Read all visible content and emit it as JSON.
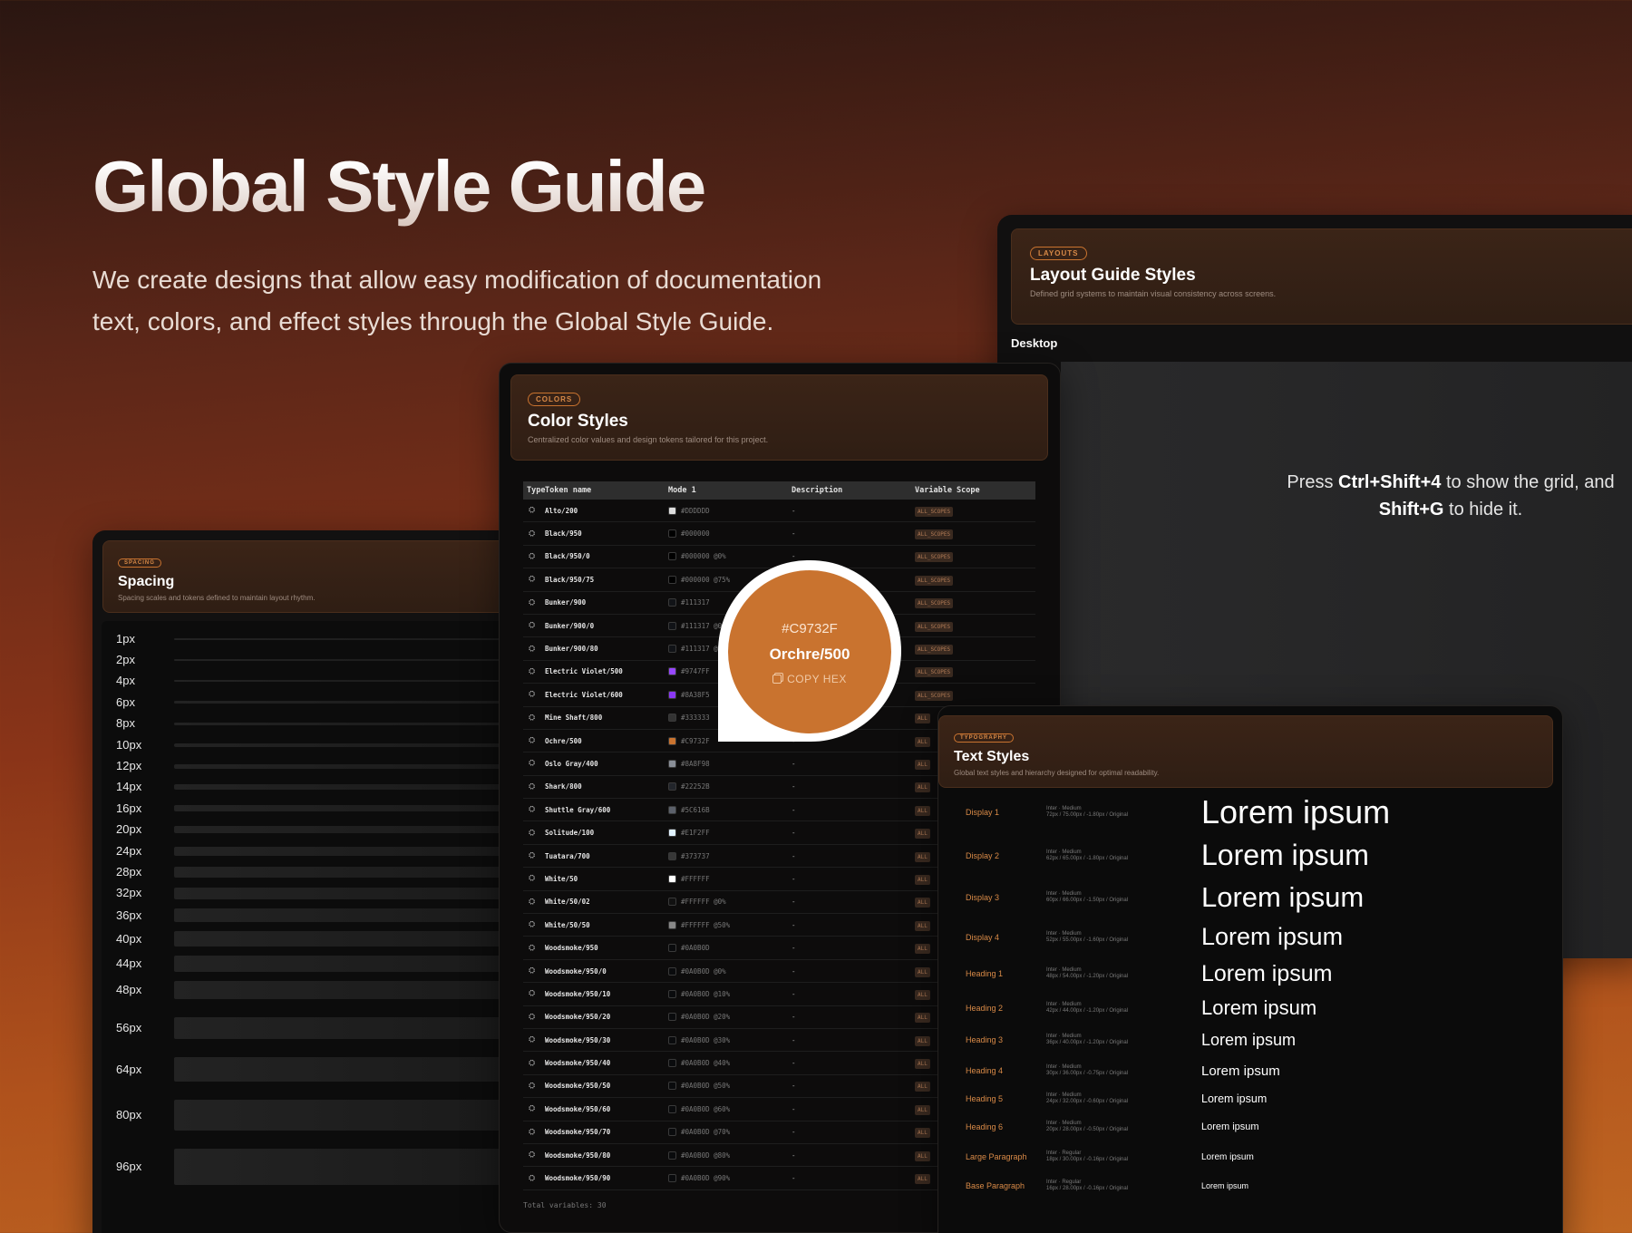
{
  "hero": {
    "title": "Global Style Guide",
    "subtitle": "We create designs that allow easy modification of documentation text, colors, and effect styles through the Global Style Guide."
  },
  "layout_panel": {
    "tag": "LAYOUTS",
    "title": "Layout Guide Styles",
    "description": "Defined grid systems to maintain visual consistency across screens.",
    "section_label": "Desktop",
    "hint_prefix": "Press ",
    "hint_key1": "Ctrl+Shift+4",
    "hint_mid": " to show the grid, and ",
    "hint_key2": "Shift+G",
    "hint_suffix": " to hide it."
  },
  "spacing_panel": {
    "tag": "SPACING",
    "title": "Spacing",
    "description": "Spacing scales and tokens defined to maintain layout rhythm.",
    "items": [
      {
        "label": "1px",
        "value": 1
      },
      {
        "label": "2px",
        "value": 2
      },
      {
        "label": "4px",
        "value": 4
      },
      {
        "label": "6px",
        "value": 6
      },
      {
        "label": "8px",
        "value": 8
      },
      {
        "label": "10px",
        "value": 10
      },
      {
        "label": "12px",
        "value": 12
      },
      {
        "label": "14px",
        "value": 14
      },
      {
        "label": "16px",
        "value": 16
      },
      {
        "label": "20px",
        "value": 20
      },
      {
        "label": "24px",
        "value": 24
      },
      {
        "label": "28px",
        "value": 28
      },
      {
        "label": "32px",
        "value": 32
      },
      {
        "label": "36px",
        "value": 36
      },
      {
        "label": "40px",
        "value": 40
      },
      {
        "label": "44px",
        "value": 44
      },
      {
        "label": "48px",
        "value": 48
      },
      {
        "label": "56px",
        "value": 56
      },
      {
        "label": "64px",
        "value": 64
      },
      {
        "label": "80px",
        "value": 80
      },
      {
        "label": "96px",
        "value": 96
      }
    ]
  },
  "color_panel": {
    "tag": "COLORS",
    "title": "Color Styles",
    "description": "Centralized color values and design tokens tailored for this project.",
    "columns": [
      "Type",
      "Token name",
      "Mode 1",
      "Description",
      "Variable Scope"
    ],
    "scope_label": "ALL_SCOPES",
    "scope_short": "ALL",
    "type_icon": "⛭",
    "total": "Total variables: 30",
    "rows": [
      {
        "name": "Alto/200",
        "value": "#DDDDDD",
        "color": "#DDDDDD"
      },
      {
        "name": "Black/950",
        "value": "#000000",
        "color": "#000000"
      },
      {
        "name": "Black/950/0",
        "value": "#000000 @0%",
        "color": "#000000"
      },
      {
        "name": "Black/950/75",
        "value": "#000000 @75%",
        "color": "#000000"
      },
      {
        "name": "Bunker/900",
        "value": "#111317",
        "color": "#111317"
      },
      {
        "name": "Bunker/900/0",
        "value": "#111317 @0%",
        "color": "#111317"
      },
      {
        "name": "Bunker/900/80",
        "value": "#111317 @80%",
        "color": "#111317"
      },
      {
        "name": "Electric Violet/500",
        "value": "#9747FF",
        "color": "#9747FF"
      },
      {
        "name": "Electric Violet/600",
        "value": "#8A38F5",
        "color": "#8A38F5"
      },
      {
        "name": "Mine Shaft/800",
        "value": "#333333",
        "color": "#333333"
      },
      {
        "name": "Ochre/500",
        "value": "#C9732F",
        "color": "#C9732F"
      },
      {
        "name": "Oslo Gray/400",
        "value": "#8A8F98",
        "color": "#8A8F98"
      },
      {
        "name": "Shark/800",
        "value": "#22252B",
        "color": "#22252B"
      },
      {
        "name": "Shuttle Gray/600",
        "value": "#5C616B",
        "color": "#5C616B"
      },
      {
        "name": "Solitude/100",
        "value": "#E1F2FF",
        "color": "#E1F2FF"
      },
      {
        "name": "Tuatara/700",
        "value": "#373737",
        "color": "#373737"
      },
      {
        "name": "White/50",
        "value": "#FFFFFF",
        "color": "#FFFFFF"
      },
      {
        "name": "White/50/02",
        "value": "#FFFFFF @0%",
        "color": "#111111"
      },
      {
        "name": "White/50/50",
        "value": "#FFFFFF @50%",
        "color": "#888888"
      },
      {
        "name": "Woodsmoke/950",
        "value": "#0A0B0D",
        "color": "#0A0B0D"
      },
      {
        "name": "Woodsmoke/950/0",
        "value": "#0A0B0D @0%",
        "color": "#0A0B0D"
      },
      {
        "name": "Woodsmoke/950/10",
        "value": "#0A0B0D @10%",
        "color": "#0A0B0D"
      },
      {
        "name": "Woodsmoke/950/20",
        "value": "#0A0B0D @20%",
        "color": "#0A0B0D"
      },
      {
        "name": "Woodsmoke/950/30",
        "value": "#0A0B0D @30%",
        "color": "#0A0B0D"
      },
      {
        "name": "Woodsmoke/950/40",
        "value": "#0A0B0D @40%",
        "color": "#0A0B0D"
      },
      {
        "name": "Woodsmoke/950/50",
        "value": "#0A0B0D @50%",
        "color": "#0A0B0D"
      },
      {
        "name": "Woodsmoke/950/60",
        "value": "#0A0B0D @60%",
        "color": "#0A0B0D"
      },
      {
        "name": "Woodsmoke/950/70",
        "value": "#0A0B0D @70%",
        "color": "#0A0B0D"
      },
      {
        "name": "Woodsmoke/950/80",
        "value": "#0A0B0D @80%",
        "color": "#0A0B0D"
      },
      {
        "name": "Woodsmoke/950/90",
        "value": "#0A0B0D @90%",
        "color": "#0A0B0D"
      }
    ]
  },
  "callout": {
    "hex": "#C9732F",
    "name": "Orchre/500",
    "copy_label": "COPY HEX",
    "color": "#C9732F"
  },
  "text_panel": {
    "tag": "TYPOGRAPHY",
    "title": "Text Styles",
    "description": "Global text styles and hierarchy designed for optimal readability.",
    "sample": "Lorem ipsum",
    "styles": [
      {
        "name": "Display 1",
        "font": "Inter · Medium",
        "spec": "72px / 75.00px / -1.80px / Original",
        "size": 36
      },
      {
        "name": "Display 2",
        "font": "Inter · Medium",
        "spec": "62px / 65.00px / -1.80px / Original",
        "size": 32
      },
      {
        "name": "Display 3",
        "font": "Inter · Medium",
        "spec": "60px / 66.00px / -1.50px / Original",
        "size": 31
      },
      {
        "name": "Display 4",
        "font": "Inter · Medium",
        "spec": "52px / 55.00px / -1.60px / Original",
        "size": 27
      },
      {
        "name": "Heading 1",
        "font": "Inter · Medium",
        "spec": "48px / 54.00px / -1.20px / Original",
        "size": 25
      },
      {
        "name": "Heading 2",
        "font": "Inter · Medium",
        "spec": "42px / 44.00px / -1.20px / Original",
        "size": 22
      },
      {
        "name": "Heading 3",
        "font": "Inter · Medium",
        "spec": "36px / 40.00px / -1.20px / Original",
        "size": 18
      },
      {
        "name": "Heading 4",
        "font": "Inter · Medium",
        "spec": "30px / 36.00px / -0.75px / Original",
        "size": 15
      },
      {
        "name": "Heading 5",
        "font": "Inter · Medium",
        "spec": "24px / 32.00px / -0.60px / Original",
        "size": 12.5
      },
      {
        "name": "Heading 6",
        "font": "Inter · Medium",
        "spec": "20px / 28.00px / -0.50px / Original",
        "size": 11
      },
      {
        "name": "Large Paragraph",
        "font": "Inter · Regular",
        "spec": "18px / 30.00px / -0.16px / Original",
        "size": 10
      },
      {
        "name": "Base Paragraph",
        "font": "Inter · Regular",
        "spec": "16px / 28.00px / -0.16px / Original",
        "size": 9
      }
    ]
  }
}
